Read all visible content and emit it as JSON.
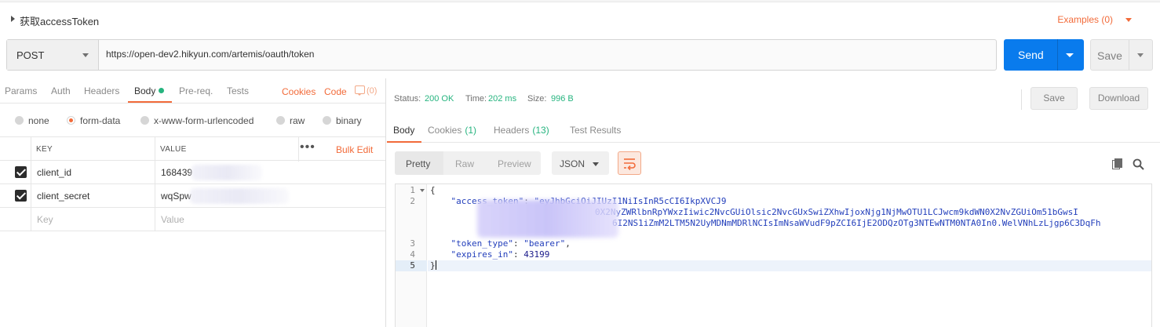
{
  "request": {
    "name": "获取accessToken",
    "examples_label": "Examples (0)",
    "method": "POST",
    "url": "https://open-dev2.hikyun.com/artemis/oauth/token",
    "send_label": "Send",
    "save_label": "Save"
  },
  "request_tabs": {
    "params": "Params",
    "auth": "Auth",
    "headers": "Headers",
    "body": "Body",
    "prereq": "Pre-req.",
    "tests": "Tests",
    "cookies": "Cookies",
    "code": "Code",
    "comments_count": "(0)"
  },
  "body_modes": [
    {
      "label": "none",
      "selected": false
    },
    {
      "label": "form-data",
      "selected": true
    },
    {
      "label": "x-www-form-urlencoded",
      "selected": false
    },
    {
      "label": "raw",
      "selected": false
    },
    {
      "label": "binary",
      "selected": false
    }
  ],
  "form_table": {
    "key_header": "KEY",
    "value_header": "VALUE",
    "bulk_edit": "Bulk Edit",
    "rows": [
      {
        "checked": true,
        "key": "client_id",
        "value": "168439"
      },
      {
        "checked": true,
        "key": "client_secret",
        "value": "wqSpw"
      }
    ],
    "key_placeholder": "Key",
    "value_placeholder": "Value"
  },
  "response": {
    "status_label": "Status:",
    "status_value": "200 OK",
    "time_label": "Time:",
    "time_value": "202 ms",
    "size_label": "Size:",
    "size_value": "996 B",
    "save_label": "Save",
    "download_label": "Download",
    "tabs": {
      "body": "Body",
      "cookies": "Cookies",
      "cookies_count": "(1)",
      "headers": "Headers",
      "headers_count": "(13)",
      "test_results": "Test Results"
    },
    "view_modes": [
      "Pretty",
      "Raw",
      "Preview"
    ],
    "format": "JSON",
    "line_numbers": [
      "1",
      "2",
      "3",
      "4",
      "5"
    ],
    "code": {
      "open_brace": "{",
      "access_token_key": "\"access_token\"",
      "access_token_value_line1": "\"eyJhbGciOiJIUzI1NiIsInR5cCI6IkpXVCJ9",
      "access_token_value_line2": "0X2NyZWRlbnRpYWxzIiwic2NvcGUiOlsic2NvcGUxSwiZXhwIjoxNjg1NjMwOTU1LCJwcm9kdWN0X2NvZGUiOm51bGwsI",
      "access_token_value_line3": "6I2NS1iZmM2LTM5N2UyMDNmMDRlNCIsImNsaWVudF9pZCI6IjE2ODQzOTg3NTEwNTM0NTA0In0.WelVNhLzLjgp6C3DqFh",
      "token_type_key": "\"token_type\"",
      "token_type_value": "\"bearer\"",
      "expires_in_key": "\"expires_in\"",
      "expires_in_value": "43199",
      "close_brace": "}"
    }
  },
  "colors": {
    "accent": "#f26b3a",
    "send_blue": "#097bed",
    "success_green": "#26b47f",
    "json_blue": "#223ebb"
  }
}
